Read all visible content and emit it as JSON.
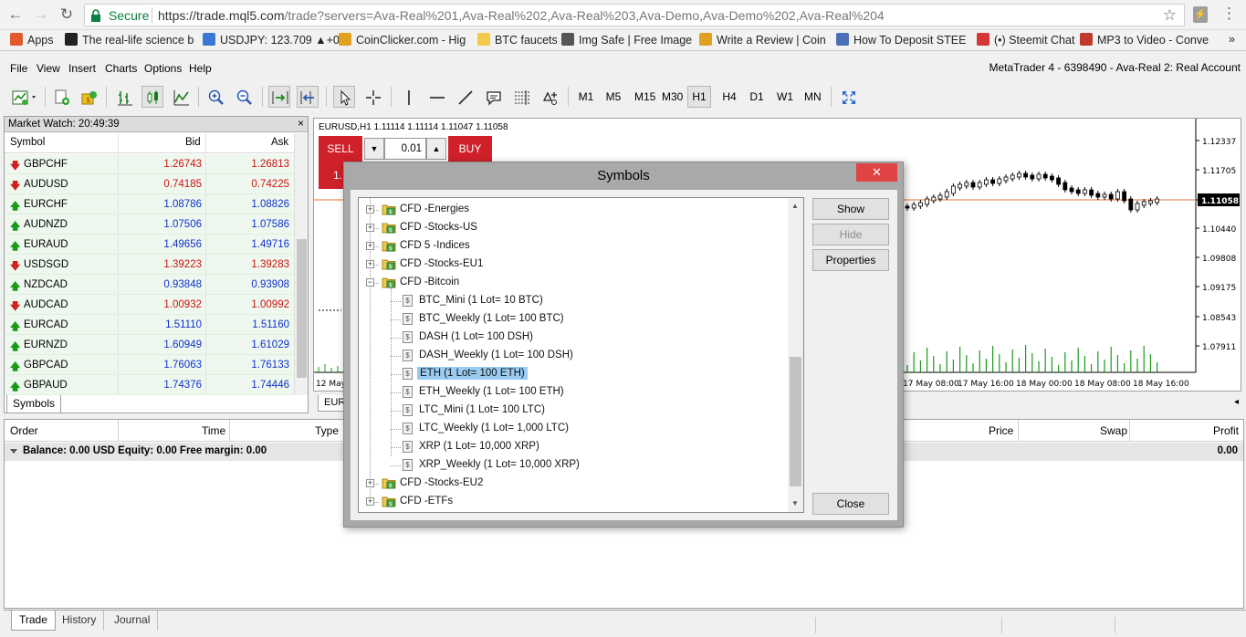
{
  "browser": {
    "secure_label": "Secure",
    "url_host": "https://trade.mql5.com",
    "url_path": "/trade?servers=Ava-Real%201,Ava-Real%202,Ava-Real%203,Ava-Demo,Ava-Demo%202,Ava-Real%204",
    "bookmarks": [
      {
        "label": "Apps",
        "icon": "apps-grid-icon",
        "color": "#e05a2b"
      },
      {
        "label": "The real-life science b",
        "icon": "bookmark-icon",
        "color": "#222222"
      },
      {
        "label": "USDJPY: 123.709 ▲+0",
        "icon": "cloud-icon",
        "color": "#3a78d6"
      },
      {
        "label": "CoinClicker.com - Hig",
        "icon": "coin-icon",
        "color": "#e0a020"
      },
      {
        "label": "BTC faucets",
        "icon": "folder-icon",
        "color": "#f2c94c"
      },
      {
        "label": "Img Safe | Free Image",
        "icon": "image-icon",
        "color": "#555555"
      },
      {
        "label": "Write a Review | Coin",
        "icon": "coin-icon",
        "color": "#e0a020"
      },
      {
        "label": "How To Deposit STEE",
        "icon": "steem-icon",
        "color": "#4a6fb5"
      },
      {
        "label": "(•) Steemit Chat",
        "icon": "chat-icon",
        "color": "#d43535"
      },
      {
        "label": "MP3 to Video - Conve",
        "icon": "video-icon",
        "color": "#c0392b"
      }
    ]
  },
  "menu": [
    "File",
    "View",
    "Insert",
    "Charts",
    "Options",
    "Help"
  ],
  "account_title": "MetaTrader 4 - 6398490 - Ava-Real 2: Real Account",
  "timeframes": [
    {
      "label": "M1",
      "active": false
    },
    {
      "label": "M5",
      "active": false
    },
    {
      "label": "M15",
      "active": false
    },
    {
      "label": "M30",
      "active": false
    },
    {
      "label": "H1",
      "active": true
    },
    {
      "label": "H4",
      "active": false
    },
    {
      "label": "D1",
      "active": false
    },
    {
      "label": "W1",
      "active": false
    },
    {
      "label": "MN",
      "active": false
    }
  ],
  "market_watch": {
    "title": "Market Watch: 20:49:39",
    "close": "×",
    "headers": {
      "symbol": "Symbol",
      "bid": "Bid",
      "ask": "Ask"
    },
    "tab": "Symbols",
    "rows": [
      {
        "symbol": "GBPCHF",
        "bid": "1.26743",
        "ask": "1.26813",
        "dir": "down"
      },
      {
        "symbol": "AUDUSD",
        "bid": "0.74185",
        "ask": "0.74225",
        "dir": "down"
      },
      {
        "symbol": "EURCHF",
        "bid": "1.08786",
        "ask": "1.08826",
        "dir": "up"
      },
      {
        "symbol": "AUDNZD",
        "bid": "1.07506",
        "ask": "1.07586",
        "dir": "up"
      },
      {
        "symbol": "EURAUD",
        "bid": "1.49656",
        "ask": "1.49716",
        "dir": "up"
      },
      {
        "symbol": "USDSGD",
        "bid": "1.39223",
        "ask": "1.39283",
        "dir": "down"
      },
      {
        "symbol": "NZDCAD",
        "bid": "0.93848",
        "ask": "0.93908",
        "dir": "up"
      },
      {
        "symbol": "AUDCAD",
        "bid": "1.00932",
        "ask": "1.00992",
        "dir": "down"
      },
      {
        "symbol": "EURCAD",
        "bid": "1.51110",
        "ask": "1.51160",
        "dir": "up"
      },
      {
        "symbol": "EURNZD",
        "bid": "1.60949",
        "ask": "1.61029",
        "dir": "up"
      },
      {
        "symbol": "GBPCAD",
        "bid": "1.76063",
        "ask": "1.76133",
        "dir": "up"
      },
      {
        "symbol": "GBPAUD",
        "bid": "1.74376",
        "ask": "1.74446",
        "dir": "up"
      }
    ]
  },
  "chart": {
    "info": "EURUSD,H1  1.11114 1.11114 1.11047 1.11058",
    "tab": "EUR",
    "current_price": "1.11058",
    "price_ticks": [
      "1.12337",
      "1.11705",
      "1.11058",
      "1.10440",
      "1.09808",
      "1.09175",
      "1.08543",
      "1.07911"
    ],
    "time_ticks": [
      "12 May",
      "17 May 08:00",
      "17 May 16:00",
      "18 May 00:00",
      "18 May 08:00",
      "18 May 16:00"
    ],
    "trade": {
      "sell": "SELL",
      "buy": "BUY",
      "lot": "0.01",
      "price_prefix": "1."
    },
    "colors": {
      "price_line": "#e07030",
      "volume": "#1a9a1a",
      "sell": "#d0202a"
    }
  },
  "terminal": {
    "headers": [
      "Order",
      "Time",
      "Type",
      "Price",
      "Swap",
      "Profit"
    ],
    "balance": "Balance: 0.00 USD  Equity: 0.00  Free margin: 0.00",
    "profit": "0.00",
    "tabs": [
      {
        "label": "Trade",
        "active": true
      },
      {
        "label": "History",
        "active": false
      },
      {
        "label": "Journal",
        "active": false
      }
    ]
  },
  "dialog": {
    "title": "Symbols",
    "close": "✕",
    "buttons": {
      "show": "Show",
      "hide": "Hide",
      "properties": "Properties",
      "close": "Close"
    },
    "tree": [
      {
        "label": "CFD -Energies",
        "kind": "folder",
        "expanded": false
      },
      {
        "label": "CFD -Stocks-US",
        "kind": "folder",
        "expanded": false
      },
      {
        "label": "CFD 5 -Indices",
        "kind": "folder",
        "expanded": false
      },
      {
        "label": "CFD -Stocks-EU1",
        "kind": "folder",
        "expanded": false
      },
      {
        "label": "CFD -Bitcoin",
        "kind": "folder",
        "expanded": true
      },
      {
        "label": "BTC_Mini  (1 Lot= 10 BTC)",
        "kind": "leaf"
      },
      {
        "label": "BTC_Weekly  (1 Lot= 100 BTC)",
        "kind": "leaf"
      },
      {
        "label": "DASH  (1 Lot= 100 DSH)",
        "kind": "leaf"
      },
      {
        "label": "DASH_Weekly  (1 Lot= 100 DSH)",
        "kind": "leaf"
      },
      {
        "label": "ETH  (1 Lot= 100 ETH)",
        "kind": "leaf",
        "selected": true
      },
      {
        "label": "ETH_Weekly  (1 Lot= 100 ETH)",
        "kind": "leaf"
      },
      {
        "label": "LTC_Mini  (1 Lot= 100 LTC)",
        "kind": "leaf"
      },
      {
        "label": "LTC_Weekly  (1 Lot= 1,000 LTC)",
        "kind": "leaf"
      },
      {
        "label": "XRP  (1 Lot= 10,000 XRP)",
        "kind": "leaf"
      },
      {
        "label": "XRP_Weekly  (1 Lot= 10,000 XRP)",
        "kind": "leaf"
      },
      {
        "label": "CFD -Stocks-EU2",
        "kind": "folder",
        "expanded": false
      },
      {
        "label": "CFD -ETFs",
        "kind": "folder",
        "expanded": false
      }
    ]
  }
}
